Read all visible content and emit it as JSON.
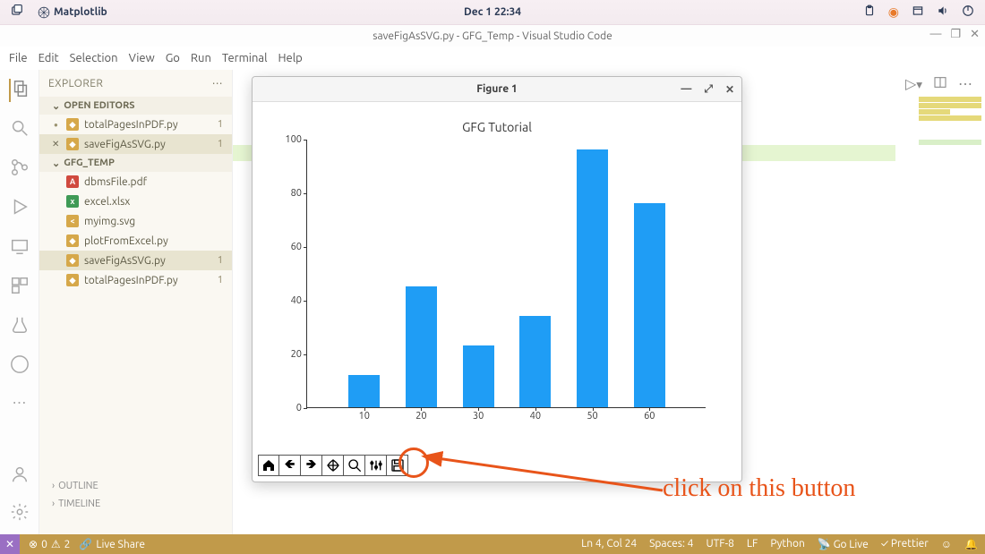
{
  "system": {
    "app_name": "Matplotlib",
    "clock": "Dec 1  22:34"
  },
  "vscode": {
    "window_title": "saveFigAsSVG.py - GFG_Temp - Visual Studio Code",
    "menu": [
      "File",
      "Edit",
      "Selection",
      "View",
      "Go",
      "Run",
      "Terminal",
      "Help"
    ],
    "explorer": {
      "title": "EXPLORER",
      "open_editors_label": "OPEN EDITORS",
      "open_editors": [
        {
          "name": "totalPagesInPDF.py",
          "dirty": true,
          "badge": "1"
        },
        {
          "name": "saveFigAsSVG.py",
          "dirty": false,
          "closeable": true,
          "badge": "1",
          "selected": true
        }
      ],
      "folder_label": "GFG_TEMP",
      "files": [
        {
          "name": "dbmsFile.pdf",
          "icon": "pdf"
        },
        {
          "name": "excel.xlsx",
          "icon": "xls"
        },
        {
          "name": "myimg.svg",
          "icon": "svg"
        },
        {
          "name": "plotFromExcel.py",
          "icon": "py"
        },
        {
          "name": "saveFigAsSVG.py",
          "icon": "py",
          "badge": "1",
          "selected": true
        },
        {
          "name": "totalPagesInPDF.py",
          "icon": "py",
          "badge": "1"
        }
      ],
      "outline_label": "OUTLINE",
      "timeline_label": "TIMELINE"
    },
    "status": {
      "errors": "0",
      "warnings": "2",
      "live_share": "Live Share",
      "cursor": "Ln 4, Col 24",
      "spaces": "Spaces: 4",
      "encoding": "UTF-8",
      "eol": "LF",
      "lang": "Python",
      "golive": "Go Live",
      "prettier": "Prettier"
    }
  },
  "mpl": {
    "figure_title": "Figure 1",
    "toolbar": [
      "home",
      "back",
      "forward",
      "pan",
      "zoom",
      "configure",
      "save"
    ]
  },
  "annotation": {
    "text": "click on this button"
  },
  "chart_data": {
    "type": "bar",
    "title": "GFG Tutorial",
    "categories": [
      10,
      20,
      30,
      40,
      50,
      60
    ],
    "values": [
      12,
      45,
      23,
      34,
      96,
      76
    ],
    "ylim": [
      0,
      100
    ],
    "yticks": [
      0,
      20,
      40,
      60,
      80,
      100
    ]
  }
}
